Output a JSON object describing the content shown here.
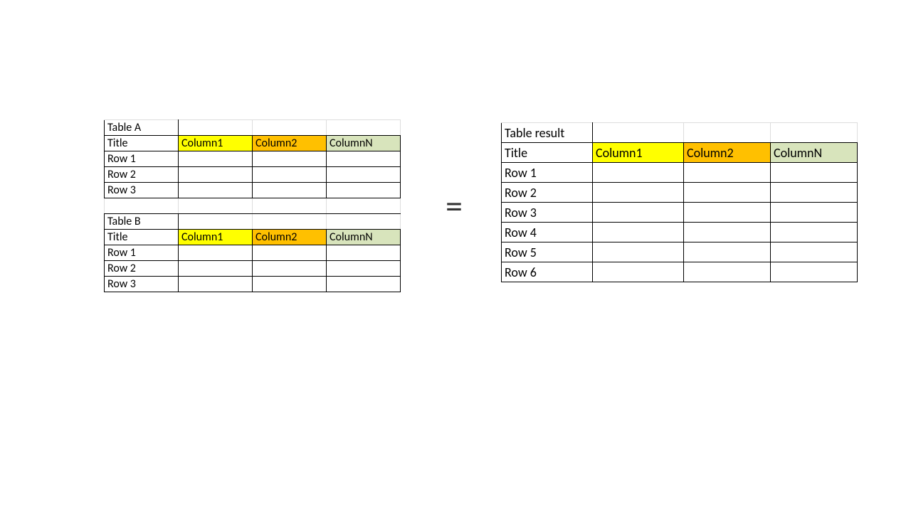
{
  "colors": {
    "col1": "#ffff00",
    "col2": "#ffc000",
    "colN": "#d8e4bc"
  },
  "left": {
    "tableA": {
      "name": "Table A",
      "title": "Title",
      "columns": [
        "Column1",
        "Column2",
        "ColumnN"
      ],
      "rows": [
        "Row 1",
        "Row 2",
        "Row 3"
      ]
    },
    "tableB": {
      "name": "Table B",
      "title": "Title",
      "columns": [
        "Column1",
        "Column2",
        "ColumnN"
      ],
      "rows": [
        "Row 1",
        "Row 2",
        "Row 3"
      ]
    }
  },
  "operator": "=",
  "result": {
    "name": "Table result",
    "title": "Title",
    "columns": [
      "Column1",
      "Column2",
      "ColumnN"
    ],
    "rows": [
      "Row 1",
      "Row 2",
      "Row 3",
      "Row 4",
      "Row 5",
      "Row 6"
    ]
  }
}
